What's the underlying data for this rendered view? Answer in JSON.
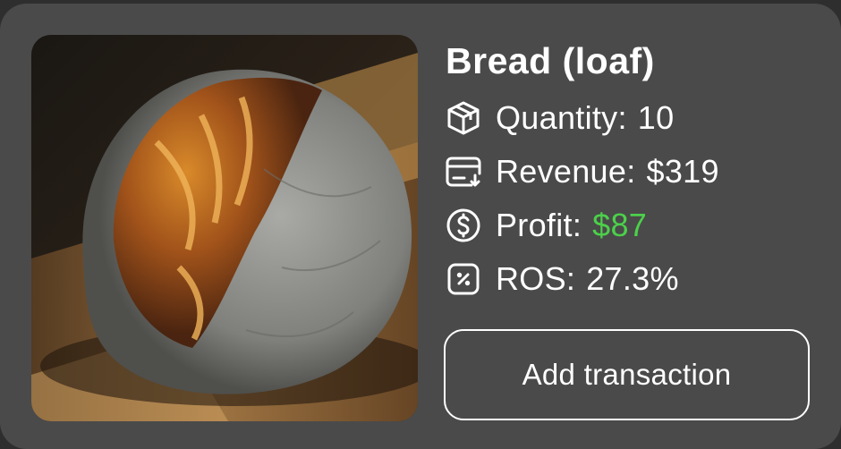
{
  "product": {
    "name": "Bread (loaf)",
    "image_icon": "bread-photo"
  },
  "stats": {
    "quantity": {
      "label": "Quantity:",
      "value": "10",
      "icon": "box-icon"
    },
    "revenue": {
      "label": "Revenue:",
      "value": "$319",
      "icon": "receipt-icon"
    },
    "profit": {
      "label": "Profit:",
      "value": "$87",
      "icon": "dollar-coin-icon",
      "color": "#4cd04a"
    },
    "ros": {
      "label": "ROS:",
      "value": "27.3%",
      "icon": "percent-icon"
    }
  },
  "actions": {
    "add_transaction_label": "Add transaction"
  },
  "colors": {
    "card_bg": "#4a4a4a",
    "page_bg": "#2e2e2e",
    "text": "#ffffff",
    "profit": "#4cd04a"
  }
}
